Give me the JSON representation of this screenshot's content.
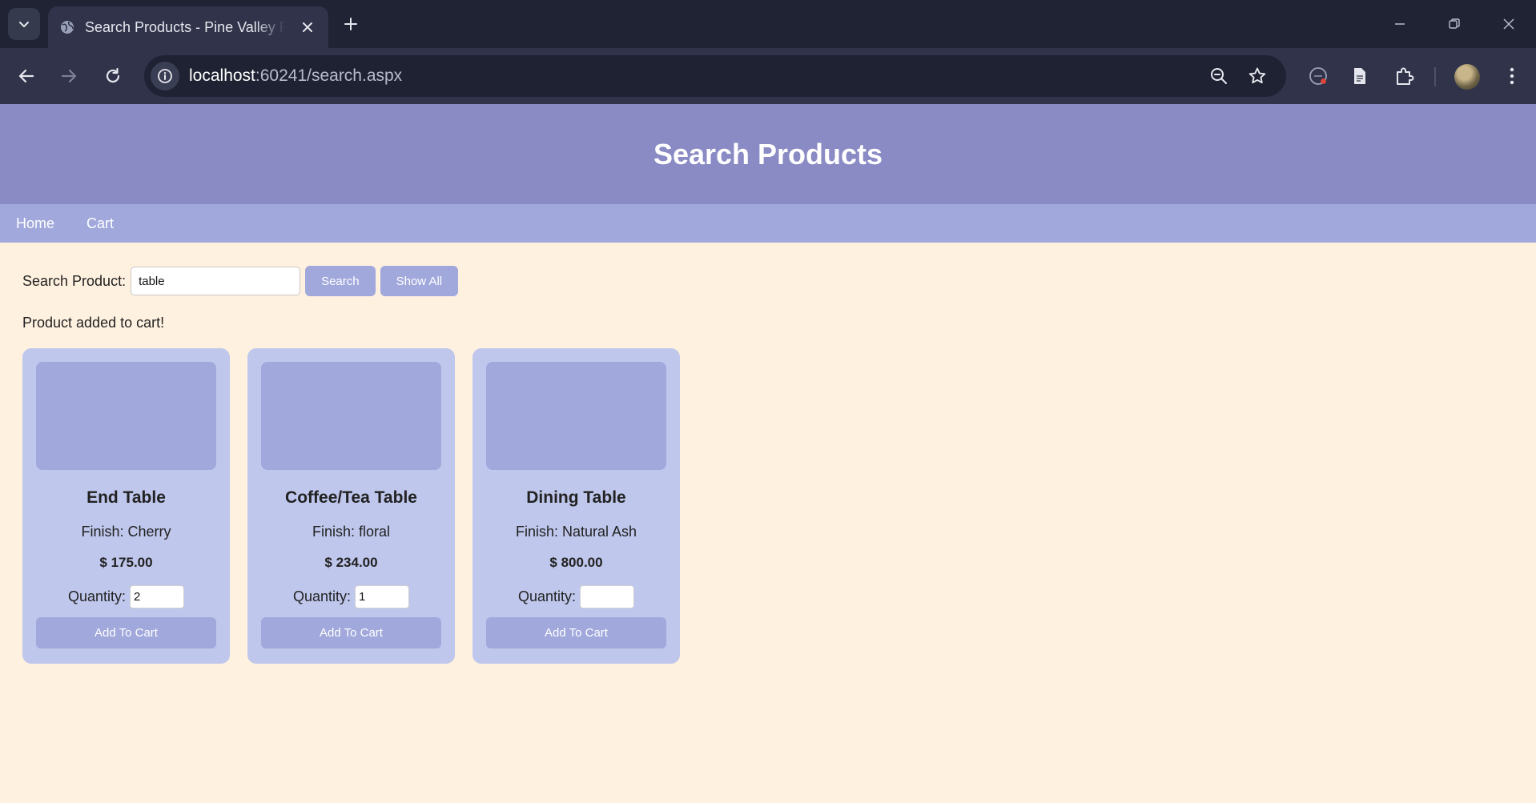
{
  "browser": {
    "tab_title": "Search Products - Pine Valley Furniture",
    "url_host": "localhost",
    "url_rest": ":60241/search.aspx"
  },
  "header": {
    "title": "Search Products"
  },
  "nav": {
    "items": [
      {
        "label": "Home"
      },
      {
        "label": "Cart"
      }
    ]
  },
  "search": {
    "label": "Search Product:",
    "value": "table",
    "search_button": "Search",
    "show_all_button": "Show All"
  },
  "message": "Product added to cart!",
  "products": [
    {
      "name": "End Table",
      "finish": "Finish: Cherry",
      "price": "$ 175.00",
      "quantity_label": "Quantity:",
      "quantity": "2",
      "add_button": "Add To Cart"
    },
    {
      "name": "Coffee/Tea Table",
      "finish": "Finish: floral",
      "price": "$ 234.00",
      "quantity_label": "Quantity:",
      "quantity": "1",
      "add_button": "Add To Cart"
    },
    {
      "name": "Dining Table",
      "finish": "Finish: Natural Ash",
      "price": "$ 800.00",
      "quantity_label": "Quantity:",
      "quantity": "",
      "add_button": "Add To Cart"
    }
  ],
  "colors": {
    "page_background": "#fff1e0",
    "header_background": "#8a8ac4",
    "nav_background": "#a0a8dc",
    "card_background": "#bfc7ec",
    "button_background": "#a0a8dc"
  }
}
